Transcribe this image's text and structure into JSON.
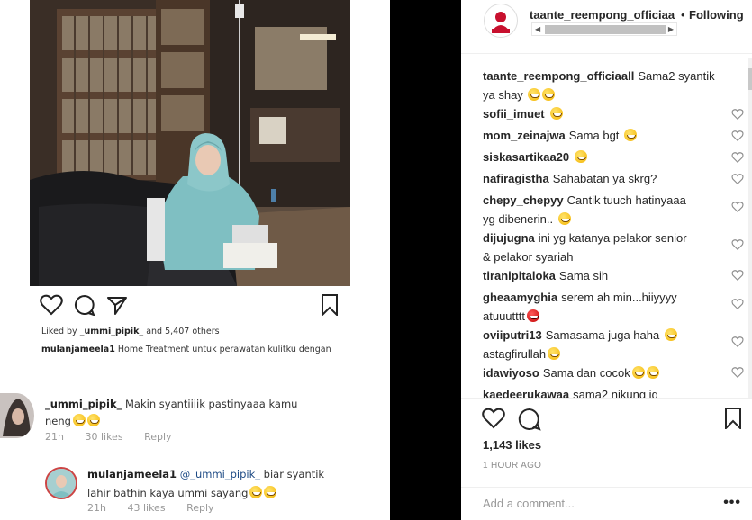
{
  "inner_post": {
    "liked_by_prefix": "Liked by",
    "liked_by_user": "_ummi_pipik_",
    "liked_by_suffix": "and 5,407 others",
    "caption_user": "mulanjameela1",
    "caption_text": "Home Treatment untuk perawatan kulitku dengan",
    "comment1": {
      "user": "_ummi_pipik_",
      "text": "Makin syantiiiik pastinyaaa kamu",
      "text2": "neng",
      "age": "21h",
      "likes": "30 likes",
      "reply": "Reply"
    },
    "comment2": {
      "user": "mulanjameela1",
      "mention": "@_ummi_pipik_",
      "text": "biar syantik",
      "text2": "lahir bathin kaya ummi sayang",
      "age": "21h",
      "likes": "43 likes",
      "reply": "Reply"
    }
  },
  "header": {
    "username": "taante_reempong_officiaa",
    "dot": "•",
    "follow_label": "Following"
  },
  "comments": [
    {
      "user": "taante_reempong_officiaall",
      "text": "Sama2 syantik",
      "text2": "ya shay"
    },
    {
      "user": "sofii_imuet",
      "text": ""
    },
    {
      "user": "mom_zeinajwa",
      "text": "Sama bgt"
    },
    {
      "user": "siskasartikaa20",
      "text": ""
    },
    {
      "user": "nafiragistha",
      "text": "Sahabatan ya skrg?"
    },
    {
      "user": "chepy_chepyy",
      "text": "Cantik tuuch hatinyaaa",
      "text2": "yg dibenerin.."
    },
    {
      "user": "dijujugna",
      "text": "ini yg katanya pelakor senior",
      "text2": "& pelakor syariah"
    },
    {
      "user": "tiranipitaloka",
      "text": "Sama sih"
    },
    {
      "user": "gheaamyghia",
      "text": "serem ah min...hiiyyyy",
      "text2": "atuuutttt"
    },
    {
      "user": "oviiputri13",
      "text": "Samasama juga haha",
      "text2": "astagfirullah"
    },
    {
      "user": "idawiyoso",
      "text": "Sama dan cocok"
    },
    {
      "user": "kaedeerukawaa",
      "text": "sama2 nikung ig"
    }
  ],
  "likes": "1,143 likes",
  "time": "1 HOUR AGO",
  "add_comment_placeholder": "Add a comment...",
  "more": "•••"
}
